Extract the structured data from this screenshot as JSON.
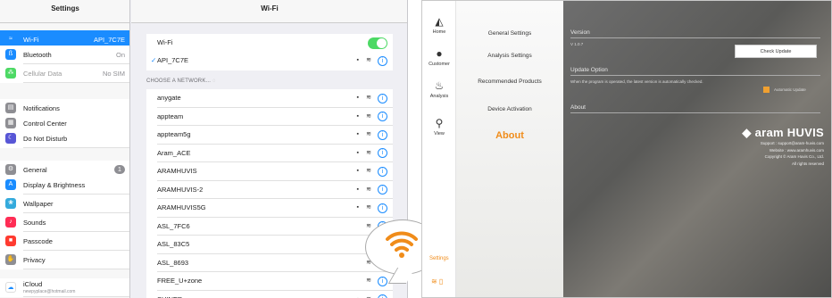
{
  "settings": {
    "sidebar_title": "Settings",
    "items": [
      {
        "label": "Wi-Fi",
        "value": "API_7C7E",
        "icon": "wifi-icon",
        "color": "#1a8cff",
        "glyph": "≈"
      },
      {
        "label": "Bluetooth",
        "value": "On",
        "icon": "bluetooth-icon",
        "color": "#1a8cff",
        "glyph": "ß"
      },
      {
        "label": "Cellular Data",
        "value": "No SIM",
        "icon": "cellular-icon",
        "color": "#4cd964",
        "glyph": "⁂"
      },
      {
        "label": "Notifications",
        "value": "",
        "icon": "notifications-icon",
        "color": "#8e8e93",
        "glyph": "▤"
      },
      {
        "label": "Control Center",
        "value": "",
        "icon": "control-center-icon",
        "color": "#8e8e93",
        "glyph": "▦"
      },
      {
        "label": "Do Not Disturb",
        "value": "",
        "icon": "moon-icon",
        "color": "#5856d6",
        "glyph": "☾"
      },
      {
        "label": "General",
        "value": "1",
        "icon": "gear-icon",
        "color": "#8e8e93",
        "glyph": "⚙"
      },
      {
        "label": "Display & Brightness",
        "value": "",
        "icon": "brightness-icon",
        "color": "#1a8cff",
        "glyph": "A"
      },
      {
        "label": "Wallpaper",
        "value": "",
        "icon": "wallpaper-icon",
        "color": "#34aadc",
        "glyph": "❀"
      },
      {
        "label": "Sounds",
        "value": "",
        "icon": "sound-icon",
        "color": "#ff2d55",
        "glyph": "♪"
      },
      {
        "label": "Passcode",
        "value": "",
        "icon": "lock-icon",
        "color": "#ff3b30",
        "glyph": "■"
      },
      {
        "label": "Privacy",
        "value": "",
        "icon": "hand-icon",
        "color": "#8e8e93",
        "glyph": "✋"
      },
      {
        "label": "iCloud",
        "value": "",
        "sub": "newpyplace@hotmail.com",
        "icon": "cloud-icon",
        "color": "#ffffff",
        "glyph": "☁"
      }
    ]
  },
  "wifi": {
    "title": "Wi-Fi",
    "toggle_label": "Wi-Fi",
    "connected": "API_7C7E",
    "section_label": "CHOOSE A NETWORK...",
    "networks": [
      "anygate",
      "appteam",
      "appteam5g",
      "Aram_ACE",
      "ARAMHUVIS",
      "ARAMHUVIS-2",
      "ARAMHUVIS5G",
      "ASL_7FC6",
      "ASL_83C5",
      "ASL_8693",
      "FREE_U+zone",
      "SHINER"
    ]
  },
  "app": {
    "nav": [
      "Home",
      "Customer",
      "Analysis",
      "View"
    ],
    "menu": [
      "General Settings",
      "Analysis Settings",
      "Recommended Products",
      "Device Activation"
    ],
    "about": "About",
    "version_title": "Version",
    "version_value": "V 1.0.7",
    "check_update": "Check Update",
    "update_title": "Update Option",
    "update_text": "When the program is operated, the latest version is automatically checked.",
    "auto_update": "Automatic Update",
    "about_title": "About",
    "logo": "aram HUVIS",
    "support": "Support : support@aram-huvis.com",
    "website": "Website : www.aramhuvis.com",
    "copyright": "Copyright © Aram Huvis Co., Ltd.",
    "rights": "All rights reserved",
    "settings_label": "Settings"
  },
  "colors": {
    "accent": "#1a8cff",
    "toggle_on": "#4cd964",
    "app_accent": "#f08c1a"
  }
}
